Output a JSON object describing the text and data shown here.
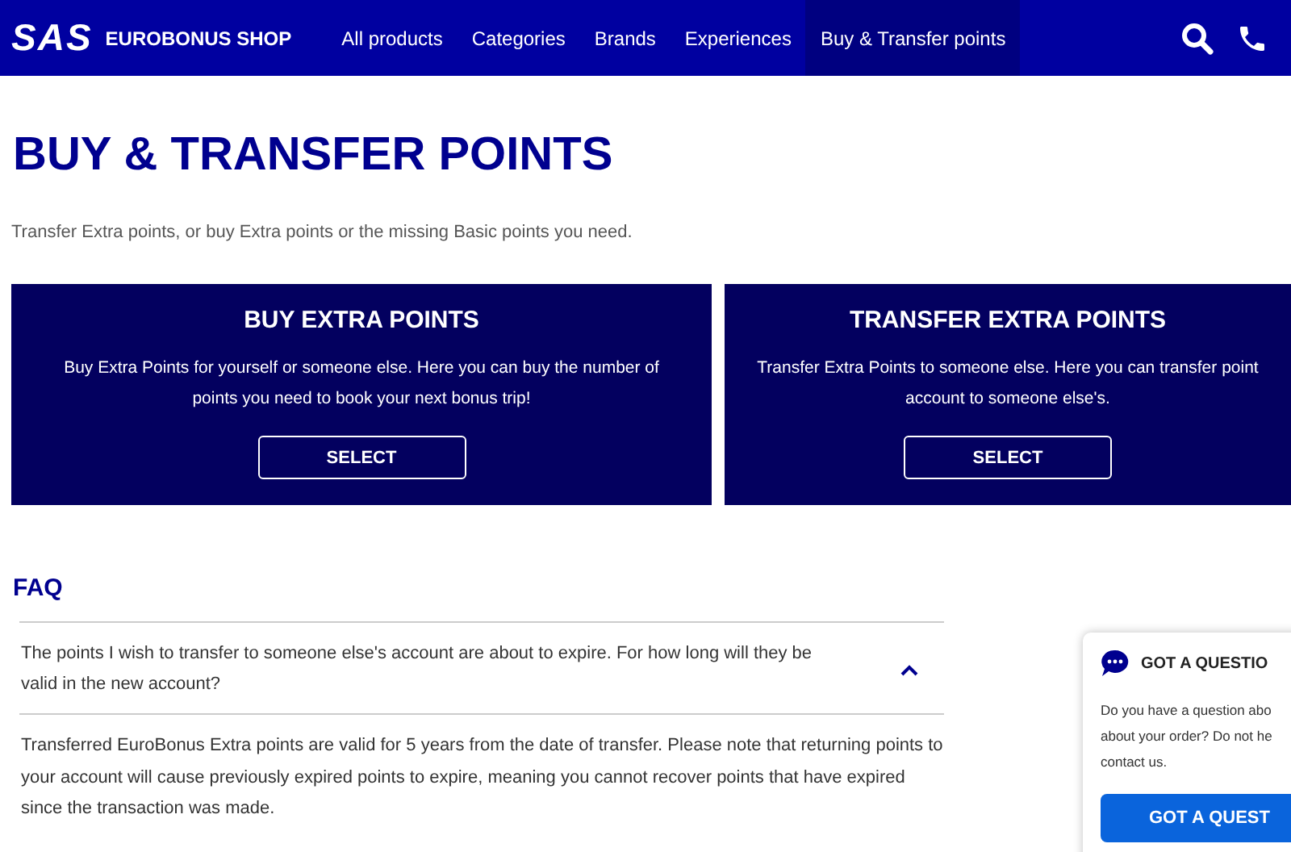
{
  "header": {
    "logo": "SAS",
    "shop_name": "EUROBONUS SHOP",
    "nav": [
      {
        "label": "All products",
        "selected": false
      },
      {
        "label": "Categories",
        "selected": false
      },
      {
        "label": "Brands",
        "selected": false
      },
      {
        "label": "Experiences",
        "selected": false
      },
      {
        "label": "Buy & Transfer points",
        "selected": true
      }
    ]
  },
  "page": {
    "title": "BUY & TRANSFER POINTS",
    "intro": "Transfer Extra points, or buy Extra points or the missing Basic points you need."
  },
  "cards": [
    {
      "title": "BUY EXTRA POINTS",
      "lines": [
        "Buy Extra Points for yourself or someone else. Here you can buy the number of",
        "points you need to book your next bonus trip!"
      ],
      "button": "SELECT"
    },
    {
      "title": "TRANSFER EXTRA POINTS",
      "lines": [
        "Transfer Extra Points to someone else. Here you can transfer point",
        "account to someone else's."
      ],
      "button": "SELECT"
    }
  ],
  "faq": {
    "title": "FAQ",
    "items": [
      {
        "question": "The points I wish to transfer to someone else's account are about to expire. For how long will they be valid in the new account?",
        "expanded": true,
        "answer": "Transferred EuroBonus Extra points are valid for 5 years from the date of transfer. Please note that returning points to your account will cause previously expired points to expire, meaning you cannot recover points that have expired since the transaction was made."
      }
    ]
  },
  "help_widget": {
    "title": "GOT A QUESTIO",
    "lines": [
      "Do you have a question abo",
      "about your order? Do not he",
      "contact us."
    ],
    "button": "GOT A QUEST"
  }
}
